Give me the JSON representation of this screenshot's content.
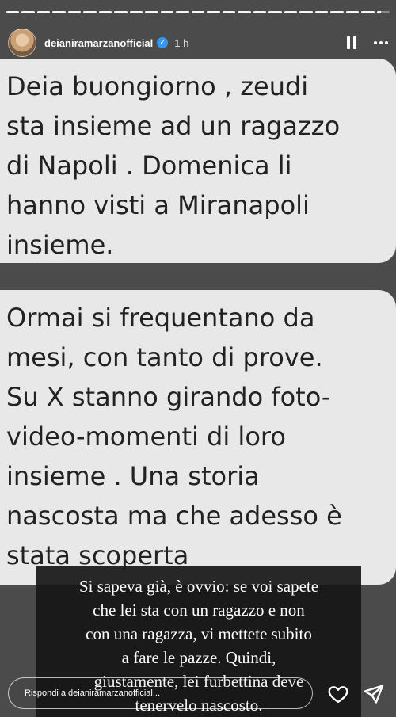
{
  "header": {
    "username": "deianiramarzanofficial",
    "time": "1 h"
  },
  "progress": {
    "segments": 25,
    "active_index": 24
  },
  "messages": [
    {
      "lines": [
        "Deia buongiorno , zeudi",
        "sta insieme ad un ragazzo",
        "di Napoli . Domenica li",
        "hanno visti a Miranapoli",
        "insieme."
      ]
    },
    {
      "lines": [
        "Ormai si frequentano da",
        "mesi, con tanto di prove.",
        "Su X stanno girando foto-",
        "video-momenti di loro",
        "insieme . Una storia",
        "nascosta ma che adesso è",
        "stata scoperta"
      ]
    }
  ],
  "caption": {
    "lines": [
      "Si sapeva già, è ovvio: se voi sapete",
      "che lei sta con un ragazzo e non",
      "con una ragazza, vi mettete subito",
      "a fare le pazze. Quindi,",
      "giustamente, lei furbettina deve",
      "tenervelo nascosto."
    ]
  },
  "reply": {
    "placeholder": "Rispondi a deianiramarzanofficial..."
  },
  "icons": {
    "verified": "verified-badge-icon",
    "pause": "pause-icon",
    "more": "more-options-icon",
    "like": "heart-icon",
    "send": "send-icon"
  },
  "colors": {
    "verified": "#3797f0",
    "card": "#e8e8e8",
    "caption_bg": "#161616"
  }
}
